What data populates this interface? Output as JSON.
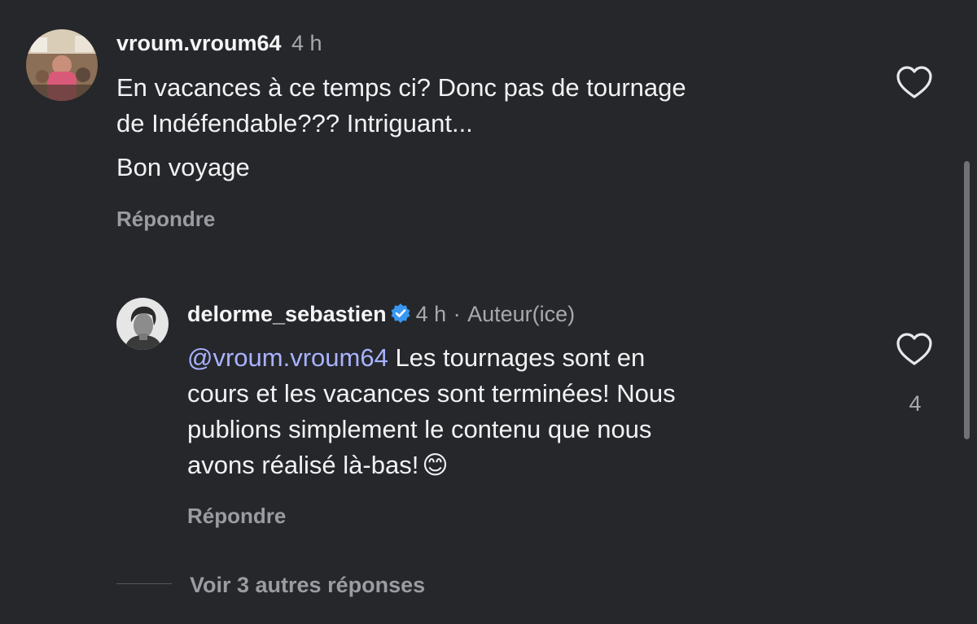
{
  "comment": {
    "username": "vroum.vroum64",
    "time": "4 h",
    "text_line1": "En vacances à ce temps ci? Donc pas de tournage",
    "text_line2": "de Indéfendable??? Intriguant...",
    "text_line3": "Bon voyage",
    "reply_label": "Répondre",
    "like_icon": "heart-outline-icon"
  },
  "reply": {
    "username": "delorme_sebastien",
    "verified_icon": "verified-badge-icon",
    "time": "4 h",
    "separator": "·",
    "author_badge": "Auteur(ice)",
    "mention": "@vroum.vroum64",
    "text_line1": " Les tournages sont en",
    "text_line2": "cours et les vacances sont terminées! Nous",
    "text_line3": "publions simplement le contenu que nous",
    "text_line4": "avons réalisé là-bas!",
    "emoji": "😊",
    "like_count": "4",
    "reply_label": "Répondre",
    "like_icon": "heart-outline-icon"
  },
  "more_replies": "Voir 3 autres réponses",
  "colors": {
    "background": "#25272b",
    "mention": "#a9b2ff",
    "verified": "#3897f0",
    "muted": "#a7a9ad"
  }
}
